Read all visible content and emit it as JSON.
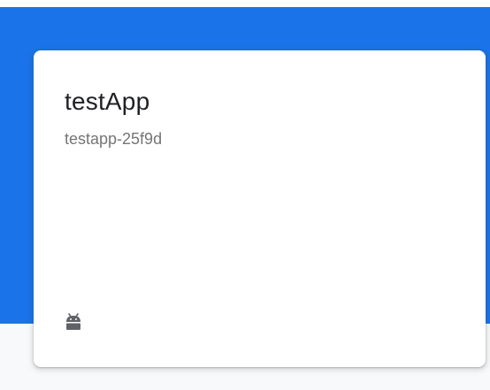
{
  "colors": {
    "header_blue": "#1a73e8",
    "page_background": "#f8f9fa",
    "card_background": "#ffffff",
    "title_text": "#202124",
    "subtitle_text": "#757575",
    "icon_color": "#5f6368"
  },
  "project_card": {
    "name": "testApp",
    "project_id": "testapp-25f9d",
    "platform_icon": "android-icon"
  }
}
